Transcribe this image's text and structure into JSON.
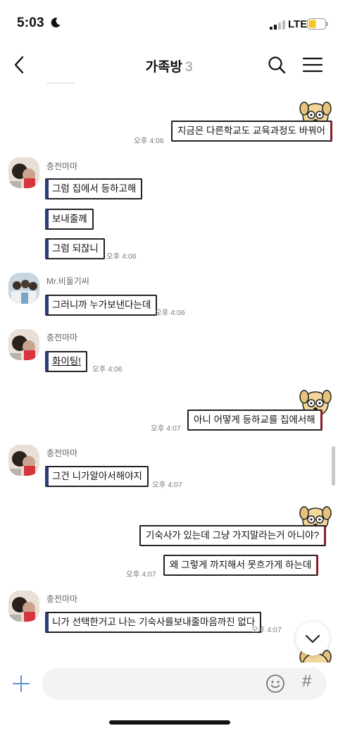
{
  "status_bar": {
    "time": "5:03",
    "network": "LTE"
  },
  "nav": {
    "title": "가족방",
    "member_count": "3"
  },
  "messages": [
    {
      "text": "지금은 다른학교도 교육과정도 바꿔어",
      "time": "오후 4:06"
    },
    {
      "sender": "충전마마",
      "texts": [
        "그럼 집에서 등하고해",
        "보내줄께",
        "그럼 되잖니"
      ],
      "time": "오후 4:06"
    },
    {
      "sender": "Mr.비둘기씨",
      "text": "그러니까 누가보낸다는데",
      "time": "오후 4:06"
    },
    {
      "sender": "충전마마",
      "text": "화이팅!",
      "time": "오후 4:06"
    },
    {
      "text": "아니 어떻게 등하교를 집에서해",
      "time": "오후 4:07"
    },
    {
      "sender": "충전마마",
      "text": "그건 니가알아서해야지",
      "time": "오후 4:07"
    },
    {
      "texts": [
        "기숙사가 있는데 그냥 가지말라는거 아니야?",
        "왜 그렇게 까지해서 못흐가게 하는데"
      ],
      "time": "오후 4:07"
    },
    {
      "sender": "충전마마",
      "text": "니가 선택한거고 나는 기숙사를보내줄마음까진 없다",
      "time": "오후 4:07"
    }
  ],
  "input": {
    "value": "",
    "placeholder": ""
  },
  "colors": {
    "bubble_border": "#222222",
    "input_bg": "#f3f3f3",
    "plus_blue": "#5b8fd6"
  },
  "icons": [
    "back-icon",
    "search-icon",
    "menu-icon",
    "plus-icon",
    "emoji-icon",
    "hash-icon",
    "chevron-down-icon",
    "dog-sticker-icon"
  ]
}
